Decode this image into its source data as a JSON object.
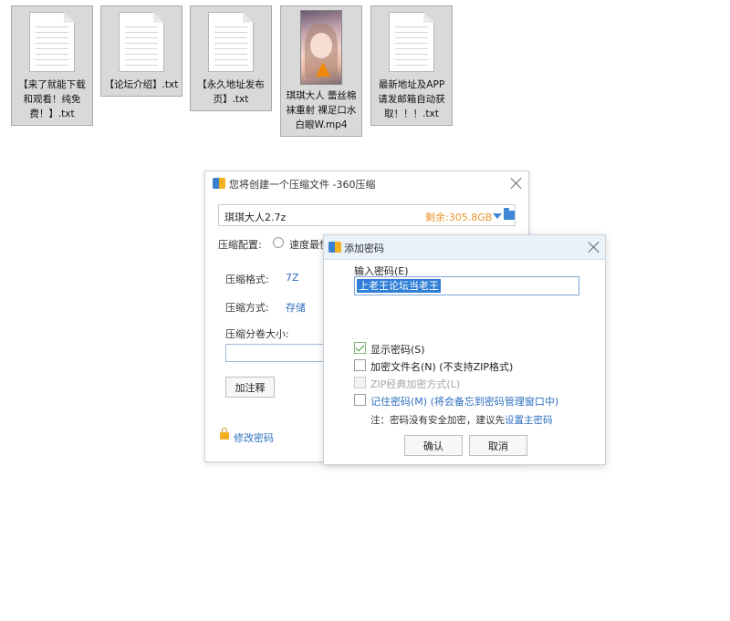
{
  "files": [
    {
      "type": "txt",
      "name": "【来了就能下载和观看！纯免费！】.txt"
    },
    {
      "type": "txt",
      "name": "【论坛介绍】.txt"
    },
    {
      "type": "txt",
      "name": "【永久地址发布页】.txt"
    },
    {
      "type": "video",
      "name": "琪琪大人 蕾丝棉袜重射 裸足口水白眼W.mp4"
    },
    {
      "type": "txt",
      "name": "最新地址及APP请发邮箱自动获取！！！.txt"
    }
  ],
  "main_dialog": {
    "title": "您将创建一个压缩文件 -360压缩",
    "archive_name": "琪琪大人2.7z",
    "free_space": "剩余:305.8GB",
    "config_label": "压缩配置:",
    "speed_option": "速度最快",
    "format_label": "压缩格式:",
    "format_value": "7Z",
    "method_label": "压缩方式:",
    "method_value": "存储",
    "volume_label": "压缩分卷大小:",
    "volume_value": "",
    "comment_button": "加注释",
    "change_password_link": "修改密码"
  },
  "password_dialog": {
    "title": "添加密码",
    "input_label": "输入密码(E)",
    "password_value": "上老王论坛当老王",
    "show_password": {
      "label": "显示密码(S)",
      "checked": true
    },
    "encrypt_filenames": {
      "label": "加密文件名(N) (不支持ZIP格式)",
      "checked": false
    },
    "zip_classic": {
      "label": "ZIP经典加密方式(L)",
      "checked": false,
      "disabled": true
    },
    "remember_password": {
      "label": "记住密码(M) (将会备忘到密码管理窗口中)",
      "checked": false
    },
    "note_prefix": "注：密码没有安全加密，建议先",
    "note_link": "设置主密码",
    "ok_button": "确认",
    "cancel_button": "取消"
  },
  "colors": {
    "accent": "#2e6fbf",
    "free_space": "#e8942c",
    "selection": "#2f7fd7"
  },
  "icons": [
    "document-icon",
    "video-thumbnail",
    "app-logo-icon",
    "close-icon",
    "dropdown-arrow-icon",
    "folder-icon",
    "lock-icon",
    "checkbox-icon"
  ]
}
